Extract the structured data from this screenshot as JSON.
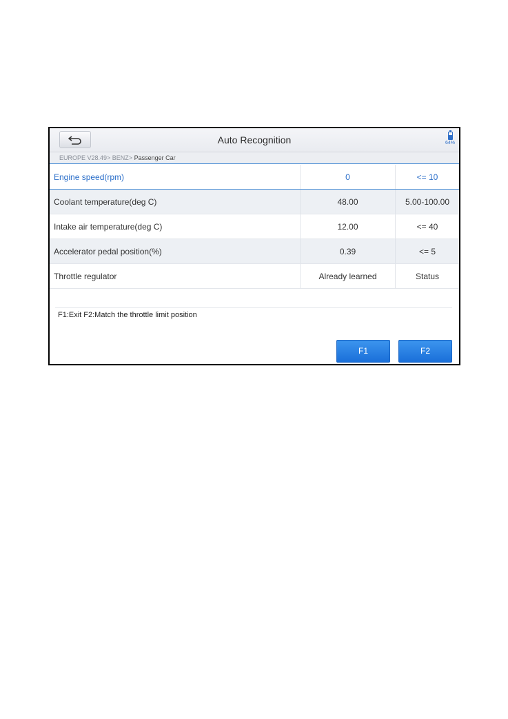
{
  "header": {
    "title": "Auto Recognition",
    "back_icon": "back-arrow-icon",
    "battery": {
      "percent_label": "64%",
      "level": 0.64,
      "color": "#2f6fc8"
    }
  },
  "breadcrumb": {
    "path": "EUROPE V28.49> BENZ> ",
    "current": "Passenger Car"
  },
  "rows": [
    {
      "name": "Engine speed(rpm)",
      "value": "0",
      "range": "<= 10"
    },
    {
      "name": "Coolant temperature(deg C)",
      "value": "48.00",
      "range": "5.00-100.00"
    },
    {
      "name": "Intake air temperature(deg C)",
      "value": "12.00",
      "range": "<= 40"
    },
    {
      "name": "Accelerator pedal position(%)",
      "value": "0.39",
      "range": "<= 5"
    },
    {
      "name": "Throttle regulator",
      "value": "Already learned",
      "range": "Status"
    }
  ],
  "info_text": "F1:Exit F2:Match the throttle limit position",
  "buttons": {
    "f1": "F1",
    "f2": "F2"
  },
  "colors": {
    "accent": "#2a6ec9",
    "button": "#1a6fd9"
  }
}
